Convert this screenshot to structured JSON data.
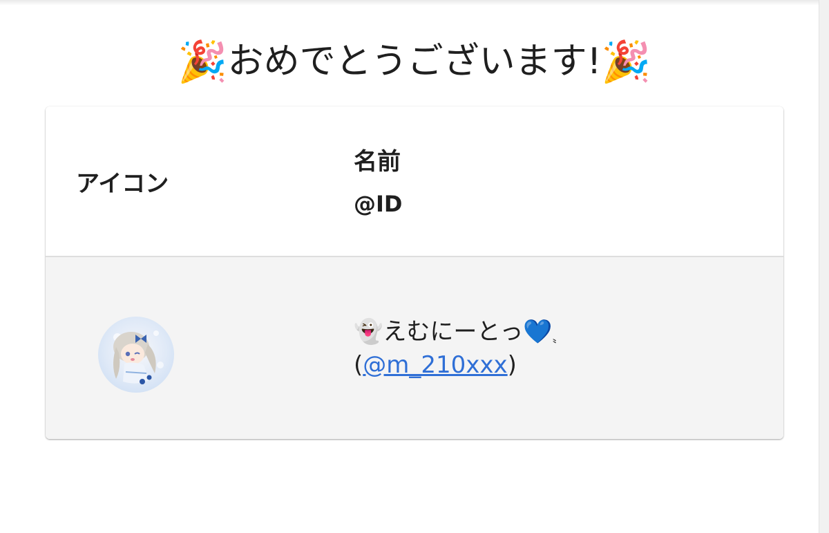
{
  "title": {
    "left_emoji": "🎉",
    "text": "おめでとうございます!",
    "right_emoji": "🎉"
  },
  "table": {
    "headers": {
      "icon": "アイコン",
      "name": "名前",
      "id": "@ID"
    },
    "rows": [
      {
        "name_emoji": "👻",
        "name_text": "えむにーとっ",
        "name_heart": "💙",
        "name_suffix": "〟",
        "id_open": "(",
        "id_link": "@m_210xxx",
        "id_close": ")"
      }
    ]
  },
  "colors": {
    "link": "#2f6fd6",
    "row_background": "#f4f4f4"
  }
}
